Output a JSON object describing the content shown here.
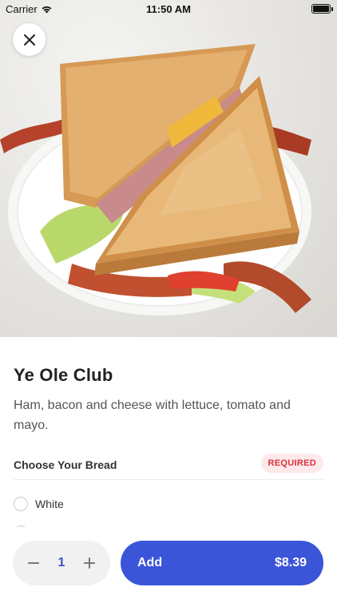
{
  "status_bar": {
    "carrier": "Carrier",
    "time": "11:50 AM"
  },
  "hero": {
    "image_description": "sandwich-photo"
  },
  "item": {
    "title": "Ye Ole Club",
    "description": "Ham, bacon and cheese with lettuce, tomato and mayo."
  },
  "options_section": {
    "title": "Choose Your Bread",
    "badge": "REQUIRED",
    "options": [
      {
        "label": "White"
      }
    ]
  },
  "order_bar": {
    "quantity": "1",
    "add_label": "Add",
    "price": "$8.39"
  },
  "colors": {
    "accent": "#3b55d9",
    "required_bg": "#fde9ea",
    "required_text": "#d9323f"
  }
}
